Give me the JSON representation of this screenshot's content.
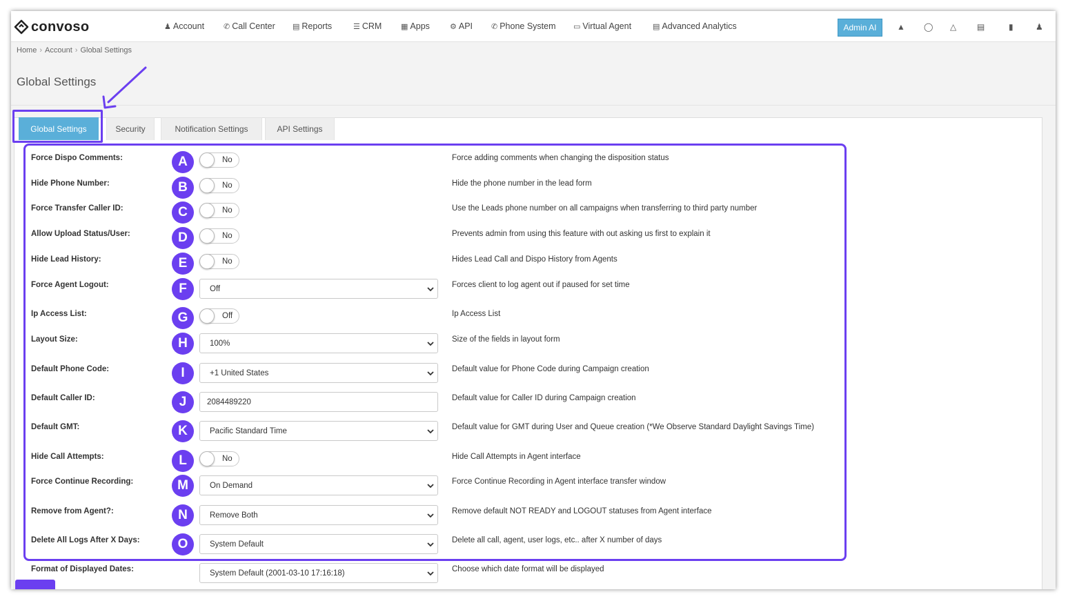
{
  "brand": {
    "logo_text": "convoso"
  },
  "nav": {
    "items": [
      {
        "label": "Account",
        "icon": "user-icon"
      },
      {
        "label": "Call Center",
        "icon": "phone-icon"
      },
      {
        "label": "Reports",
        "icon": "bar-chart-icon"
      },
      {
        "label": "CRM",
        "icon": "list-icon"
      },
      {
        "label": "Apps",
        "icon": "grid-icon"
      },
      {
        "label": "API",
        "icon": "gear-icon"
      },
      {
        "label": "Phone System",
        "icon": "phone-icon"
      },
      {
        "label": "Virtual Agent",
        "icon": "monitor-icon"
      },
      {
        "label": "Advanced Analytics",
        "icon": "bar-chart-icon"
      }
    ],
    "admin_ai": "Admin AI",
    "right_icons": [
      "bell-icon",
      "lightbulb-icon",
      "flask-icon",
      "messages-icon",
      "clipboard-icon",
      "user-icon"
    ]
  },
  "breadcrumb": [
    "Home",
    "Account",
    "Global Settings"
  ],
  "page_title": "Global Settings",
  "tabs": [
    "Global Settings",
    "Security",
    "Notification Settings",
    "API Settings"
  ],
  "settings": [
    {
      "badge": "A",
      "label": "Force Dispo Comments:",
      "control": "toggle",
      "value": "No",
      "desc": "Force adding comments when changing the disposition status"
    },
    {
      "badge": "B",
      "label": "Hide Phone Number:",
      "control": "toggle",
      "value": "No",
      "desc": "Hide the phone number in the lead form"
    },
    {
      "badge": "C",
      "label": "Force Transfer Caller ID:",
      "control": "toggle",
      "value": "No",
      "desc": "Use the Leads phone number on all campaigns when transferring to third party number"
    },
    {
      "badge": "D",
      "label": "Allow Upload Status/User:",
      "control": "toggle",
      "value": "No",
      "desc": "Prevents admin from using this feature with out asking us first to explain it"
    },
    {
      "badge": "E",
      "label": "Hide Lead History:",
      "control": "toggle",
      "value": "No",
      "desc": "Hides Lead Call and Dispo History from Agents"
    },
    {
      "badge": "F",
      "label": "Force Agent Logout:",
      "control": "select",
      "value": "Off",
      "desc": "Forces client to log agent out if paused for set time"
    },
    {
      "badge": "G",
      "label": "Ip Access List:",
      "control": "toggle",
      "value": "Off",
      "desc": "Ip Access List"
    },
    {
      "badge": "H",
      "label": "Layout Size:",
      "control": "select",
      "value": "100%",
      "desc": "Size of the fields in layout form"
    },
    {
      "badge": "I",
      "label": "Default Phone Code:",
      "control": "select",
      "value": "+1 United States",
      "desc": "Default value for Phone Code during Campaign creation"
    },
    {
      "badge": "J",
      "label": "Default Caller ID:",
      "control": "input",
      "value": "2084489220",
      "desc": "Default value for Caller ID during Campaign creation"
    },
    {
      "badge": "K",
      "label": "Default GMT:",
      "control": "select",
      "value": "Pacific Standard Time",
      "desc": "Default value for GMT during User and Queue creation (*We Observe Standard Daylight Savings Time)"
    },
    {
      "badge": "L",
      "label": "Hide Call Attempts:",
      "control": "toggle",
      "value": "No",
      "desc": "Hide Call Attempts in Agent interface"
    },
    {
      "badge": "M",
      "label": "Force Continue Recording:",
      "control": "select",
      "value": "On Demand",
      "desc": "Force Continue Recording in Agent interface transfer window"
    },
    {
      "badge": "N",
      "label": "Remove from Agent?:",
      "control": "select",
      "value": "Remove Both",
      "desc": "Remove default NOT READY and LOGOUT statuses from Agent interface"
    },
    {
      "badge": "O",
      "label": "Delete All Logs After X Days:",
      "control": "select",
      "value": "System Default",
      "desc": "Delete all call, agent, user logs, etc.. after X number of days"
    },
    {
      "badge": "",
      "label": "Format of Displayed Dates:",
      "control": "select",
      "value": "System Default (2001-03-10 17:16:18)",
      "desc": "Choose which date format will be displayed"
    }
  ],
  "colors": {
    "accent": "#6b3ff0",
    "tab_active": "#5aafd9",
    "admin_ai": "#5aafd9"
  }
}
